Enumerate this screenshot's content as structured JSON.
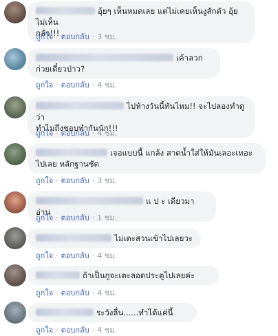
{
  "actions": {
    "like": "ถูกใจ",
    "reply": "ตอบกลับ",
    "dot": "·"
  },
  "comments": [
    {
      "line1": "อุ้ยๆ เห็นหมดเลย แต่ไม่เคยเห็นงูสักตัว อุ้ยไม่เห็น",
      "line2": "กลัว!!!",
      "time": "3 ชม."
    },
    {
      "line1": "เค้าลวก",
      "line2": "ก่วยเตี๋ยวป่าว?",
      "time": "4 ชม."
    },
    {
      "line1": "ไปห้างวันนี้ทันไหม!! จะไปลองทำดู ว่า",
      "line2": "ทำไมถึงชอบทำกันนัก!!!",
      "time": "4 ชม."
    },
    {
      "line1": "เจอแบบนี้ แกล้ง สาดน้ำใส่ให้มันเลอะเทอะ",
      "line2": "ไปเลย หลักฐานชัด",
      "time": "3 ชม."
    },
    {
      "line1": "แ ป ะ เดียวมาอ่าน",
      "line2": "",
      "time": "1 ชม."
    },
    {
      "line1": "ไม่เตะสวนเข้าไปเลยวะ",
      "line2": "",
      "time": "4 ชม."
    },
    {
      "line1": "ถ้าเป็นกูจะเตะลอดประตูไปเลยค่ะ",
      "line2": "",
      "time": "4 ชม."
    },
    {
      "line1": "ระวังลื่น......ทำได้แค่นี้",
      "line2": "",
      "time": "4 ชม."
    }
  ]
}
